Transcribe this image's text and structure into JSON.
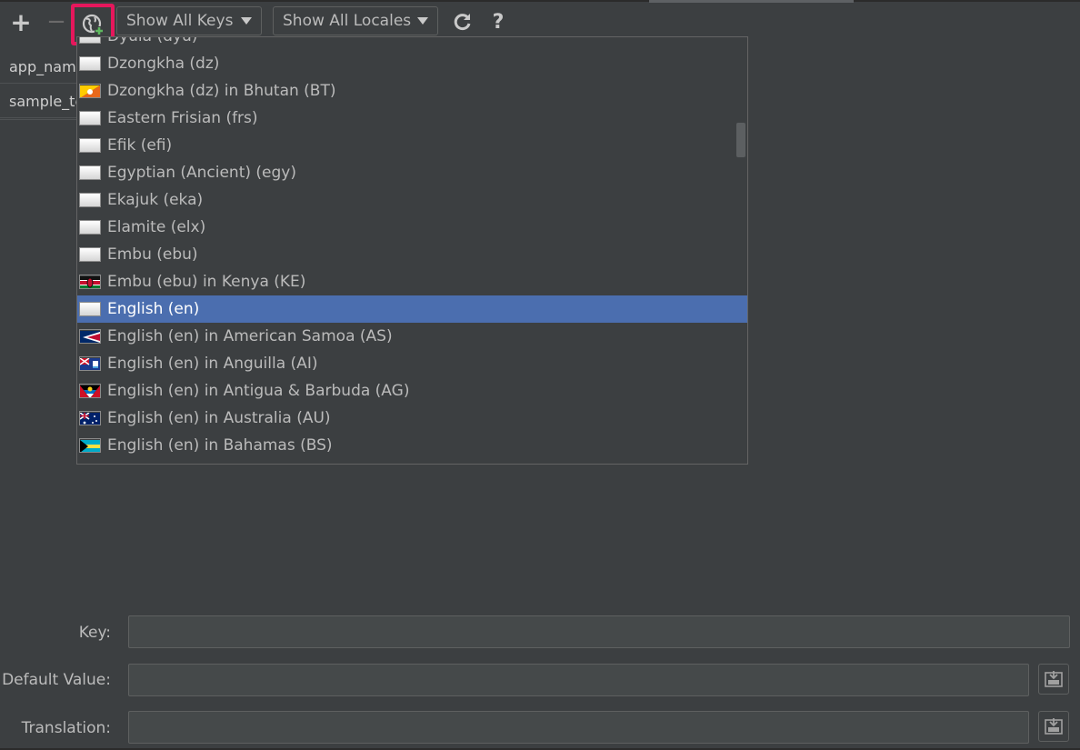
{
  "toolbar": {
    "add_icon": "plus-icon",
    "remove_icon": "minus-icon",
    "add_locale_icon": "globe-add-icon",
    "keys_filter": {
      "value": "Show All Keys"
    },
    "locales_filter": {
      "value": "Show All Locales"
    },
    "refresh_icon": "refresh-icon",
    "help_icon": "question-icon",
    "highlight_color": "#e6175c"
  },
  "keys": [
    "app_name",
    "sample_text"
  ],
  "locale_list": {
    "selected_index": 10,
    "selected_color": "#4b6eaf",
    "items": [
      {
        "label": "Dyula (dyu)",
        "flag": "blank"
      },
      {
        "label": "Dzongkha (dz)",
        "flag": "blank"
      },
      {
        "label": "Dzongkha (dz) in Bhutan (BT)",
        "flag": "bhutan"
      },
      {
        "label": "Eastern Frisian (frs)",
        "flag": "blank"
      },
      {
        "label": "Efik (efi)",
        "flag": "blank"
      },
      {
        "label": "Egyptian (Ancient) (egy)",
        "flag": "blank"
      },
      {
        "label": "Ekajuk (eka)",
        "flag": "blank"
      },
      {
        "label": "Elamite (elx)",
        "flag": "blank"
      },
      {
        "label": "Embu (ebu)",
        "flag": "blank"
      },
      {
        "label": "Embu (ebu) in Kenya (KE)",
        "flag": "kenya"
      },
      {
        "label": "English (en)",
        "flag": "blank"
      },
      {
        "label": "English (en) in American Samoa (AS)",
        "flag": "american-samoa"
      },
      {
        "label": "English (en) in Anguilla (AI)",
        "flag": "anguilla"
      },
      {
        "label": "English (en) in Antigua & Barbuda (AG)",
        "flag": "antigua"
      },
      {
        "label": "English (en) in Australia (AU)",
        "flag": "australia"
      },
      {
        "label": "English (en) in Bahamas (BS)",
        "flag": "bahamas"
      }
    ]
  },
  "form": {
    "key_label": "Key:",
    "key_value": "",
    "default_label": "Default Value:",
    "default_value": "",
    "translation_label": "Translation:",
    "translation_value": "",
    "expand_icon": "expand-editor-icon"
  }
}
